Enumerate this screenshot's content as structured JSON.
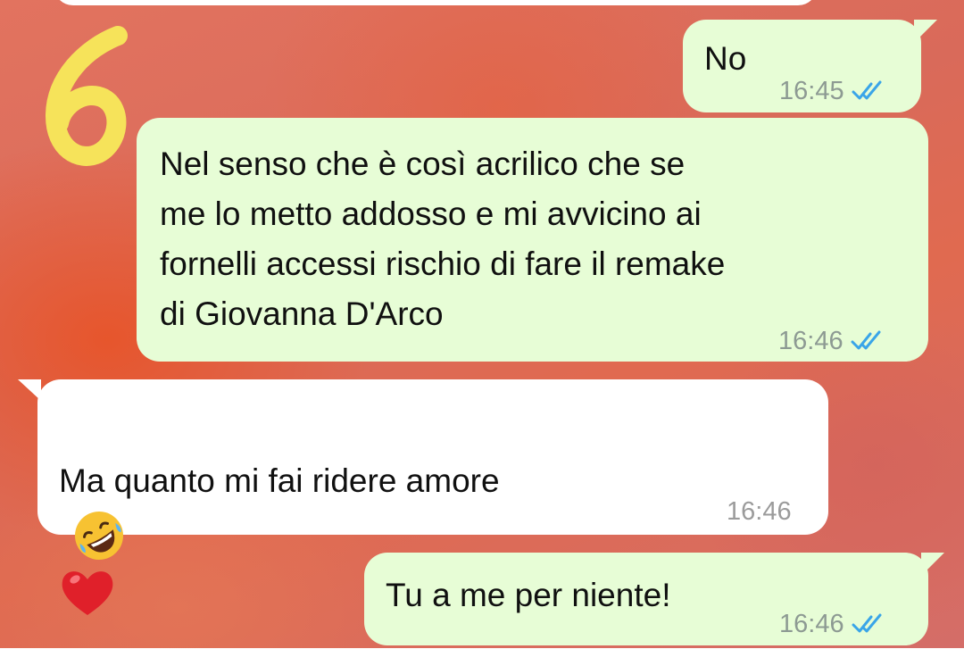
{
  "conversation": {
    "messages": [
      {
        "direction": "outgoing",
        "text": "No",
        "time": "16:45",
        "status": "read",
        "status_icon": "double-check-icon"
      },
      {
        "direction": "outgoing",
        "text": "Nel senso che è così acrilico che se\nme lo metto addosso e mi avvicino ai\nfornelli accessi rischio di fare il remake\ndi Giovanna D'Arco",
        "time": "16:46",
        "status": "read",
        "status_icon": "double-check-icon"
      },
      {
        "direction": "incoming",
        "text": "Ma quanto mi fai ridere amore",
        "emojis": [
          "rolling-on-floor-laughing-emoji",
          "red-heart-emoji"
        ],
        "time": "16:46"
      },
      {
        "direction": "outgoing",
        "text": "Tu a me per niente!",
        "time": "16:46",
        "status": "read",
        "status_icon": "double-check-icon"
      }
    ]
  },
  "overlay_annotation": {
    "text": "6",
    "color": "#f6e35a"
  },
  "colors": {
    "outgoing_bubble": "#e7fdd6",
    "incoming_bubble": "#ffffff",
    "read_tick": "#3aa5e8",
    "timestamp": "#8d9a93",
    "wallpaper": "#dc6a55"
  }
}
